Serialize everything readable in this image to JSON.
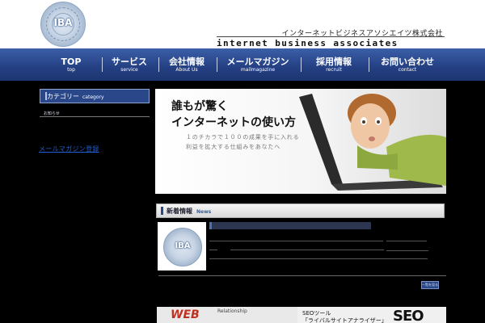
{
  "header": {
    "logo_text": "IBA",
    "company_jp": "インターネットビジネスアソシエイツ株式会社",
    "company_en": "Internet Business Associates"
  },
  "nav": {
    "items": [
      {
        "jp": "TOP",
        "en": "top"
      },
      {
        "jp": "サービス",
        "en": "service"
      },
      {
        "jp": "会社情報",
        "en": "About Us"
      },
      {
        "jp": "メールマガジン",
        "en": "mailmagazine"
      },
      {
        "jp": "採用情報",
        "en": "recruit"
      },
      {
        "jp": "お問い合わせ",
        "en": "contact"
      }
    ]
  },
  "sidebar": {
    "category_title": "カテゴリー",
    "category_sub": "category",
    "item": "お知らせ",
    "link": "メールマガジン登録"
  },
  "hero": {
    "headline1": "誰もが驚く",
    "headline2": "インターネットの使い方",
    "tagline1": "１のチカラで１００の成果を手に入れる",
    "tagline2": "利益を拡大する仕組みをあなたへ"
  },
  "news": {
    "title": "新着情報",
    "sub": "News",
    "logo_text": "IBA",
    "more_label": "一覧を見る"
  },
  "banner": {
    "word_web": "WEB",
    "word_relationship": "Relationship",
    "title1": "SEOツール",
    "title2": "「ライバルサイトアナライザー」",
    "seo": "SEO"
  }
}
